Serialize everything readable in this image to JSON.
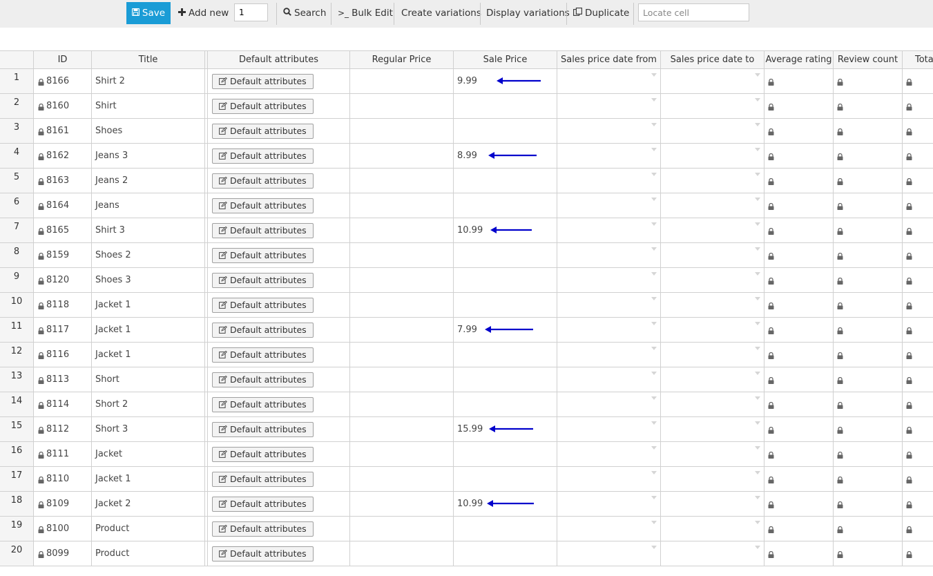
{
  "toolbar": {
    "save_label": "Save",
    "add_new_label": "Add new",
    "quantity_value": "1",
    "search_label": "Search",
    "bulk_edit_label": "Bulk Edit",
    "create_variations_label": "Create variations",
    "display_variations_label": "Display variations",
    "duplicate_label": "Duplicate",
    "locate_placeholder": "Locate cell"
  },
  "columns": {
    "id": "ID",
    "title": "Title",
    "default_attributes": "Default attributes",
    "regular_price": "Regular Price",
    "sale_price": "Sale Price",
    "date_from": "Sales price date from",
    "date_to": "Sales price date to",
    "average_rating": "Average rating",
    "review_count": "Review count",
    "total": "Tota"
  },
  "attr_button_label": "Default attributes",
  "rows": [
    {
      "num": "1",
      "id": "8166",
      "title": "Shirt 2",
      "sale_price": "9.99",
      "arrow": true
    },
    {
      "num": "2",
      "id": "8160",
      "title": "Shirt",
      "sale_price": "",
      "arrow": false
    },
    {
      "num": "3",
      "id": "8161",
      "title": "Shoes",
      "sale_price": "",
      "arrow": false
    },
    {
      "num": "4",
      "id": "8162",
      "title": "Jeans 3",
      "sale_price": "8.99",
      "arrow": true
    },
    {
      "num": "5",
      "id": "8163",
      "title": "Jeans 2",
      "sale_price": "",
      "arrow": false
    },
    {
      "num": "6",
      "id": "8164",
      "title": "Jeans",
      "sale_price": "",
      "arrow": false
    },
    {
      "num": "7",
      "id": "8165",
      "title": "Shirt 3",
      "sale_price": "10.99",
      "arrow": true
    },
    {
      "num": "8",
      "id": "8159",
      "title": "Shoes 2",
      "sale_price": "",
      "arrow": false
    },
    {
      "num": "9",
      "id": "8120",
      "title": "Shoes 3",
      "sale_price": "",
      "arrow": false
    },
    {
      "num": "10",
      "id": "8118",
      "title": "Jacket 1",
      "sale_price": "",
      "arrow": false
    },
    {
      "num": "11",
      "id": "8117",
      "title": "Jacket 1",
      "sale_price": "7.99",
      "arrow": true
    },
    {
      "num": "12",
      "id": "8116",
      "title": "Jacket 1",
      "sale_price": "",
      "arrow": false
    },
    {
      "num": "13",
      "id": "8113",
      "title": "Short",
      "sale_price": "",
      "arrow": false
    },
    {
      "num": "14",
      "id": "8114",
      "title": "Short 2",
      "sale_price": "",
      "arrow": false
    },
    {
      "num": "15",
      "id": "8112",
      "title": "Short 3",
      "sale_price": "15.99",
      "arrow": true
    },
    {
      "num": "16",
      "id": "8111",
      "title": "Jacket",
      "sale_price": "",
      "arrow": false
    },
    {
      "num": "17",
      "id": "8110",
      "title": "Jacket 1",
      "sale_price": "",
      "arrow": false
    },
    {
      "num": "18",
      "id": "8109",
      "title": "Jacket 2",
      "sale_price": "10.99",
      "arrow": true
    },
    {
      "num": "19",
      "id": "8100",
      "title": "Product",
      "sale_price": "",
      "arrow": false
    },
    {
      "num": "20",
      "id": "8099",
      "title": "Product",
      "sale_price": "",
      "arrow": false
    }
  ],
  "colors": {
    "save_bg": "#1a9cd6",
    "toolbar_bg": "#eeeeee",
    "arrow": "#0000cc",
    "grid_line": "#d0d0d0"
  },
  "icons": {
    "save": "floppy-disk-icon",
    "add": "plus-icon",
    "search": "magnifier-icon",
    "bulk_edit": "terminal-icon",
    "duplicate": "copy-icon",
    "lock": "lock-icon",
    "edit": "edit-icon",
    "dropdown": "caret-down-icon",
    "annotation": "left-arrow-icon"
  }
}
